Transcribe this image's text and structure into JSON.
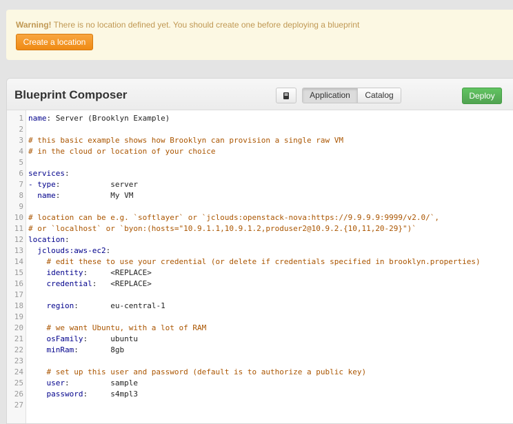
{
  "warning": {
    "bold": "Warning!",
    "text": " There is no location defined yet. You should create one before deploying a blueprint",
    "button": "Create a location"
  },
  "composer": {
    "title": "Blueprint Composer",
    "tabs": [
      "Application",
      "Catalog"
    ],
    "active_tab": "Application",
    "deploy_label": "Deploy",
    "book_icon": "book-icon"
  },
  "editor": {
    "lines": [
      {
        "n": "1",
        "parts": [
          [
            "k",
            "name"
          ],
          [
            "v",
            ": Server (Brooklyn Example)"
          ]
        ]
      },
      {
        "n": "2",
        "parts": []
      },
      {
        "n": "3",
        "parts": [
          [
            "c",
            "# this basic example shows how Brooklyn can provision a single raw VM"
          ]
        ]
      },
      {
        "n": "4",
        "parts": [
          [
            "c",
            "# in the cloud or location of your choice"
          ]
        ]
      },
      {
        "n": "5",
        "parts": []
      },
      {
        "n": "6",
        "parts": [
          [
            "k",
            "services"
          ],
          [
            "v",
            ":"
          ]
        ]
      },
      {
        "n": "7",
        "parts": [
          [
            "k",
            "- type"
          ],
          [
            "v",
            ":           server"
          ]
        ]
      },
      {
        "n": "8",
        "parts": [
          [
            "k",
            "  name"
          ],
          [
            "v",
            ":           My VM"
          ]
        ]
      },
      {
        "n": "9",
        "parts": []
      },
      {
        "n": "10",
        "parts": [
          [
            "c",
            "# location can be e.g. `softlayer` or `jclouds:openstack-nova:https://9.9.9.9:9999/v2.0/`,"
          ]
        ]
      },
      {
        "n": "11",
        "parts": [
          [
            "c",
            "# or `localhost` or `byon:(hosts=\"10.9.1.1,10.9.1.2,produser2@10.9.2.{10,11,20-29}\")`"
          ]
        ]
      },
      {
        "n": "12",
        "parts": [
          [
            "k",
            "location"
          ],
          [
            "v",
            ":"
          ]
        ]
      },
      {
        "n": "13",
        "parts": [
          [
            "k",
            "  jclouds:aws-ec2"
          ],
          [
            "v",
            ":"
          ]
        ]
      },
      {
        "n": "14",
        "parts": [
          [
            "c",
            "    # edit these to use your credential (or delete if credentials specified in brooklyn.properties)"
          ]
        ]
      },
      {
        "n": "15",
        "parts": [
          [
            "k",
            "    identity"
          ],
          [
            "v",
            ":     <REPLACE>"
          ]
        ]
      },
      {
        "n": "16",
        "parts": [
          [
            "k",
            "    credential"
          ],
          [
            "v",
            ":   <REPLACE>"
          ]
        ]
      },
      {
        "n": "17",
        "parts": []
      },
      {
        "n": "18",
        "parts": [
          [
            "k",
            "    region"
          ],
          [
            "v",
            ":       eu-central-1"
          ]
        ]
      },
      {
        "n": "19",
        "parts": []
      },
      {
        "n": "20",
        "parts": [
          [
            "c",
            "    # we want Ubuntu, with a lot of RAM"
          ]
        ]
      },
      {
        "n": "21",
        "parts": [
          [
            "k",
            "    osFamily"
          ],
          [
            "v",
            ":     ubuntu"
          ]
        ]
      },
      {
        "n": "22",
        "parts": [
          [
            "k",
            "    minRam"
          ],
          [
            "v",
            ":       8gb"
          ]
        ]
      },
      {
        "n": "23",
        "parts": []
      },
      {
        "n": "24",
        "parts": [
          [
            "c",
            "    # set up this user and password (default is to authorize a public key)"
          ]
        ]
      },
      {
        "n": "25",
        "parts": [
          [
            "k",
            "    user"
          ],
          [
            "v",
            ":         sample"
          ]
        ]
      },
      {
        "n": "26",
        "parts": [
          [
            "k",
            "    password"
          ],
          [
            "v",
            ":     s4mpl3"
          ]
        ]
      },
      {
        "n": "27",
        "parts": []
      }
    ]
  }
}
